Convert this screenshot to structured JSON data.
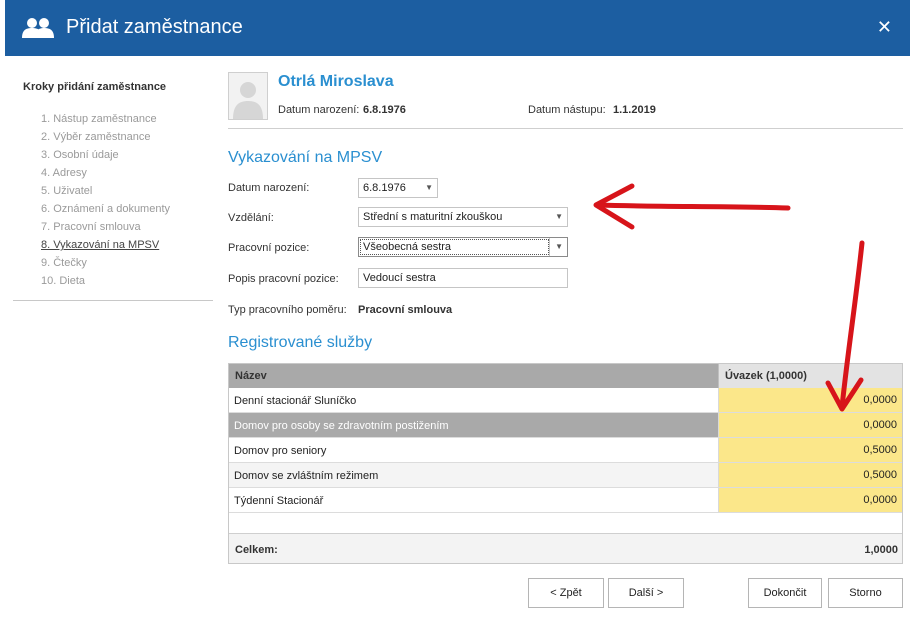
{
  "window": {
    "title": "Přidat zaměstnance"
  },
  "steps": {
    "title": "Kroky přidání zaměstnance",
    "items": [
      "1. Nástup zaměstnance",
      "2. Výběr zaměstnance",
      "3. Osobní údaje",
      "4. Adresy",
      "5. Uživatel",
      "6. Oznámení a dokumenty",
      "7. Pracovní smlouva",
      "8. Vykazování na MPSV",
      "9. Čtečky",
      "10. Dieta"
    ],
    "active_index": 7
  },
  "employee": {
    "name": "Otrlá Miroslava",
    "dob_label": "Datum narození:",
    "dob": "6.8.1976",
    "start_label": "Datum nástupu:",
    "start": "1.1.2019"
  },
  "mpsv": {
    "title": "Vykazování na MPSV",
    "dob_label": "Datum narození:",
    "dob_value": "6.8.1976",
    "education_label": "Vzdělání:",
    "education_value": "Střední s maturitní zkouškou",
    "position_label": "Pracovní pozice:",
    "position_value": "Všeobecná sestra",
    "position_desc_label": "Popis pracovní pozice:",
    "position_desc_value": "Vedoucí sestra",
    "employment_type_label": "Typ pracovního poměru:",
    "employment_type_value": "Pracovní smlouva"
  },
  "services": {
    "title": "Registrované služby",
    "col_name": "Název",
    "col_load": "Úvazek (1,0000)",
    "rows": [
      {
        "name": "Denní stacionář Sluníčko",
        "value": "0,0000"
      },
      {
        "name": "Domov pro osoby se zdravotním postižením",
        "value": "0,0000"
      },
      {
        "name": "Domov pro seniory",
        "value": "0,5000"
      },
      {
        "name": "Domov se zvláštním režimem",
        "value": "0,5000"
      },
      {
        "name": "Týdenní Stacionář",
        "value": "0,0000"
      }
    ],
    "total_label": "Celkem:",
    "total_value": "1,0000",
    "highlight_color": "#fbe78a"
  },
  "buttons": {
    "back": "< Zpět",
    "next": "Další >",
    "finish": "Dokončit",
    "cancel": "Storno"
  },
  "colors": {
    "titlebar": "#1c5ea1",
    "accent": "#2a8fd0",
    "annotation": "#d7141a"
  },
  "icons": {
    "title": "users-icon",
    "close": "close-icon",
    "avatar": "person-placeholder-icon"
  }
}
